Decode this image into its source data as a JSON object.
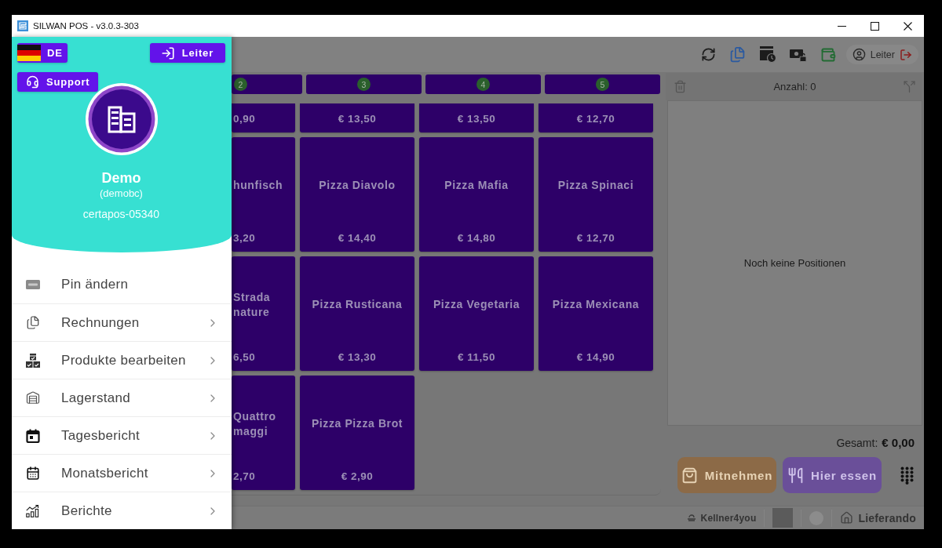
{
  "window": {
    "title": "SILWAN POS - v3.0.3-303"
  },
  "drawer": {
    "language_button": {
      "label": "DE"
    },
    "login_button": {
      "label": "Leiter"
    },
    "support_button": {
      "label": "Support"
    },
    "account": {
      "name": "Demo",
      "username": "(demobc)",
      "device": "certapos-05340"
    },
    "menu": [
      {
        "label": "Pin ändern",
        "has_submenu": false
      },
      {
        "label": "Rechnungen",
        "has_submenu": true
      },
      {
        "label": "Produkte bearbeiten",
        "has_submenu": true
      },
      {
        "label": "Lagerstand",
        "has_submenu": true
      },
      {
        "label": "Tagesbericht",
        "has_submenu": true
      },
      {
        "label": "Monatsbericht",
        "has_submenu": true
      },
      {
        "label": "Berichte",
        "has_submenu": true
      }
    ]
  },
  "toolbar": {
    "user_label": "Leiter"
  },
  "categories": [
    {
      "number": "2",
      "selected": false
    },
    {
      "number": "3",
      "selected": false
    },
    {
      "number": "4",
      "selected": false
    },
    {
      "number": "5",
      "selected": false
    }
  ],
  "products": [
    {
      "price": "0,90"
    },
    {
      "price": "€ 13,50"
    },
    {
      "price": "€ 13,50"
    },
    {
      "price": "€ 12,70"
    },
    {
      "name": "hunfisch",
      "price": "3,20"
    },
    {
      "name": "Pizza Diavolo",
      "price": "€ 14,40"
    },
    {
      "name": "Pizza Mafia",
      "price": "€ 14,80"
    },
    {
      "name": "Pizza Spinaci",
      "price": "€ 12,70"
    },
    {
      "name": "Strada nature",
      "price": "6,50"
    },
    {
      "name": "Pizza Rusticana",
      "price": "€ 13,30"
    },
    {
      "name": "Pizza Vegetaria",
      "price": "€ 11,50"
    },
    {
      "name": "Pizza Mexicana",
      "price": "€ 14,90"
    },
    {
      "name": "Quattro maggi",
      "price": "2,70"
    },
    {
      "name": "Pizza Pizza Brot",
      "price": "€ 2,90"
    }
  ],
  "order": {
    "count_label": "Anzahl: 0",
    "empty_text": "Noch keine Positionen",
    "total_label": "Gesamt:",
    "total_value": "€ 0,00"
  },
  "order_buttons": [
    {
      "kind": "takeaway",
      "label": "Mitnehmen"
    },
    {
      "kind": "dinein",
      "label": "Hier essen"
    }
  ],
  "footer": {
    "partners": [
      {
        "kind": "tray",
        "label": "Kellner4you"
      },
      {
        "kind": "tile"
      },
      {
        "kind": "round"
      },
      {
        "kind": "house",
        "label": "Lieferando"
      }
    ]
  }
}
